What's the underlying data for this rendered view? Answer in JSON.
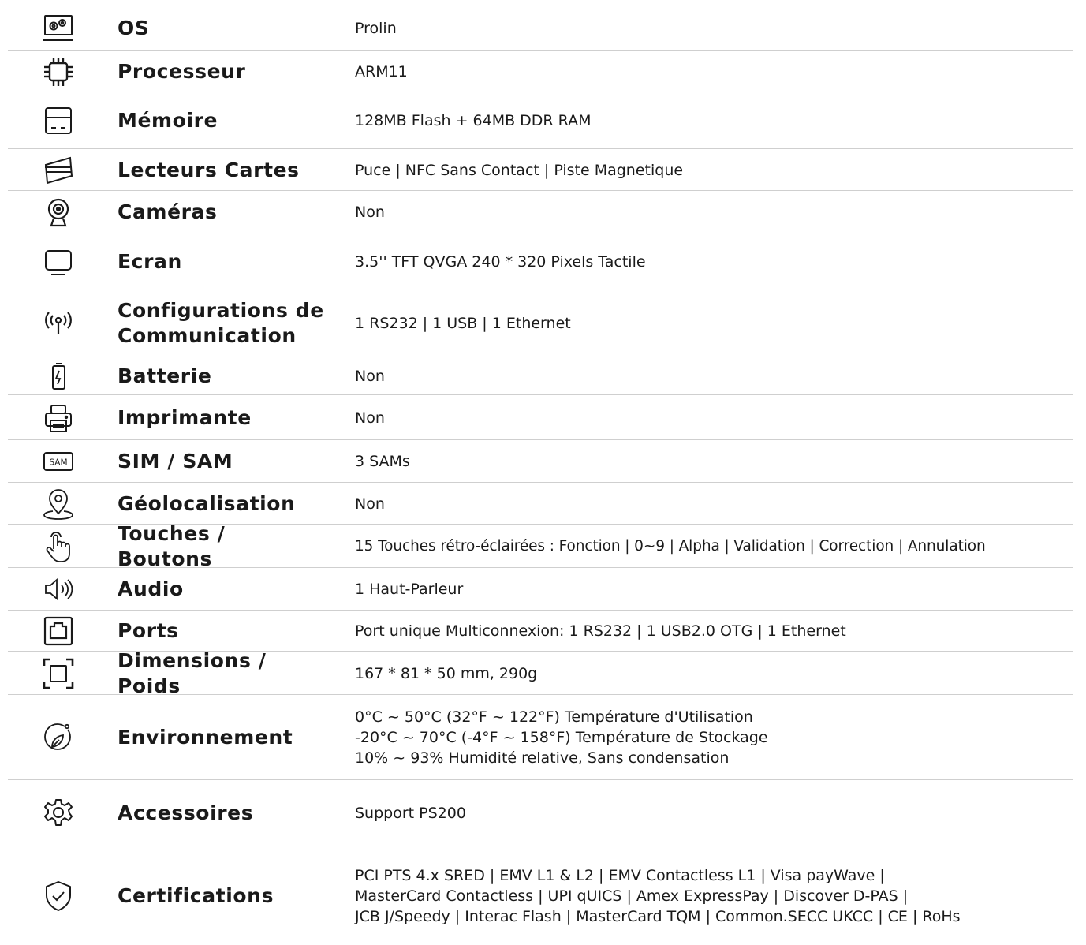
{
  "specs": [
    {
      "icon": "os-icon",
      "label": "OS",
      "value": "Prolin"
    },
    {
      "icon": "processor-icon",
      "label": "Processeur",
      "value": "ARM11"
    },
    {
      "icon": "memory-icon",
      "label": "Mémoire",
      "value": "128MB Flash + 64MB DDR RAM"
    },
    {
      "icon": "card-reader-icon",
      "label": "Lecteurs Cartes",
      "value": "Puce | NFC Sans Contact | Piste Magnetique"
    },
    {
      "icon": "camera-icon",
      "label": "Caméras",
      "value": "Non"
    },
    {
      "icon": "screen-icon",
      "label": "Ecran",
      "value": "3.5'' TFT QVGA 240 * 320 Pixels Tactile"
    },
    {
      "icon": "antenna-icon",
      "label": "Configurations de\nCommunication",
      "value": "1 RS232 | 1 USB | 1 Ethernet"
    },
    {
      "icon": "battery-icon",
      "label": "Batterie",
      "value": "Non"
    },
    {
      "icon": "printer-icon",
      "label": "Imprimante",
      "value": "Non"
    },
    {
      "icon": "sam-icon",
      "label": "SIM / SAM",
      "value": "3 SAMs",
      "icon_text": "SAM"
    },
    {
      "icon": "location-pin-icon",
      "label": "Géolocalisation",
      "value": "Non"
    },
    {
      "icon": "touch-hand-icon",
      "label": "Touches / Boutons",
      "value": "15 Touches rétro-éclairées : Fonction | 0~9 | Alpha | Validation | Correction | Annulation"
    },
    {
      "icon": "speaker-icon",
      "label": "Audio",
      "value": "1 Haut-Parleur"
    },
    {
      "icon": "ethernet-port-icon",
      "label": "Ports",
      "value": "Port unique Multiconnexion: 1 RS232 | 1 USB2.0 OTG | 1 Ethernet"
    },
    {
      "icon": "dimensions-icon",
      "label": "Dimensions / Poids",
      "value": "167 * 81 * 50 mm, 290g"
    },
    {
      "icon": "leaf-icon",
      "label": "Environnement",
      "value": "0°C ~ 50°C (32°F ~ 122°F) Température d'Utilisation\n -20°C ~ 70°C (-4°F ~ 158°F) Température de Stockage\n10% ~ 93% Humidité relative, Sans condensation"
    },
    {
      "icon": "gear-icon",
      "label": "Accessoires",
      "value": "Support PS200"
    },
    {
      "icon": "shield-check-icon",
      "label": "Certifications",
      "value": "PCI PTS 4.x SRED | EMV L1 & L2 | EMV Contactless L1 | Visa payWave |\nMasterCard Contactless | UPI qUICS | Amex ExpressPay | Discover D-PAS |\nJCB J/Speedy | Interac Flash | MasterCard TQM | Common.SECC UKCC | CE | RoHs"
    }
  ]
}
